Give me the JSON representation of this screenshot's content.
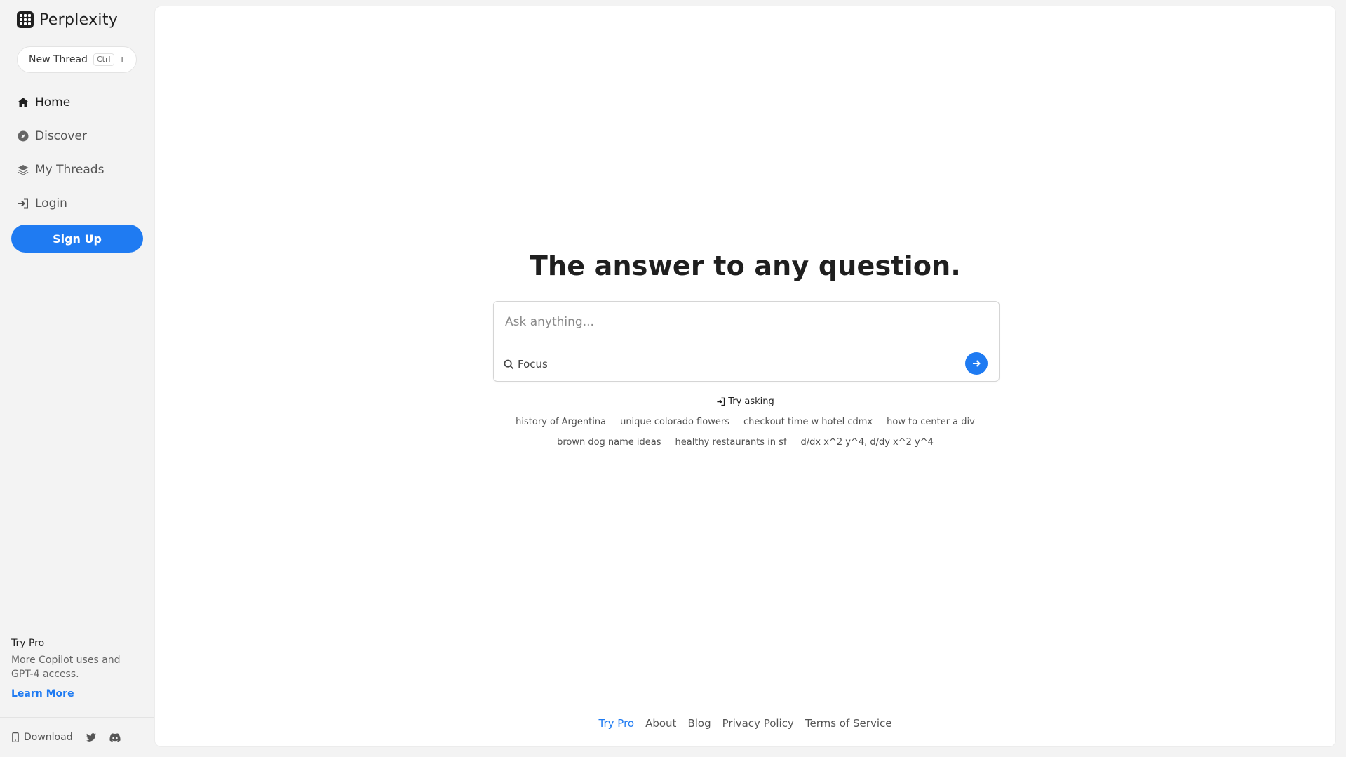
{
  "brand": {
    "name": "Perplexity"
  },
  "sidebar": {
    "new_thread": {
      "label": "New Thread",
      "kbd_ctrl": "Ctrl",
      "kbd_key": "I"
    },
    "items": [
      {
        "label": "Home",
        "icon": "home-icon",
        "active": true
      },
      {
        "label": "Discover",
        "icon": "compass-icon",
        "active": false
      },
      {
        "label": "My Threads",
        "icon": "stack-icon",
        "active": false
      },
      {
        "label": "Login",
        "icon": "login-icon",
        "active": false
      }
    ],
    "signup_label": "Sign Up",
    "try_pro": {
      "title": "Try Pro",
      "description": "More Copilot uses and GPT-4 access.",
      "link": "Learn More"
    },
    "footer": {
      "download_label": "Download"
    }
  },
  "main": {
    "headline": "The answer to any question.",
    "search": {
      "placeholder": "Ask anything...",
      "focus_label": "Focus"
    },
    "try_asking_label": "Try asking",
    "suggestions_row1": [
      "history of Argentina",
      "unique colorado flowers",
      "checkout time w hotel cdmx",
      "how to center a div"
    ],
    "suggestions_row2": [
      "brown dog name ideas",
      "healthy restaurants in sf",
      "d/dx x^2 y^4, d/dy x^2 y^4"
    ],
    "footer_links": [
      "Try Pro",
      "About",
      "Blog",
      "Privacy Policy",
      "Terms of Service"
    ]
  },
  "colors": {
    "accent": "#1f7bf2",
    "sidebar_bg": "#f3f3f3",
    "main_bg": "#ffffff"
  }
}
